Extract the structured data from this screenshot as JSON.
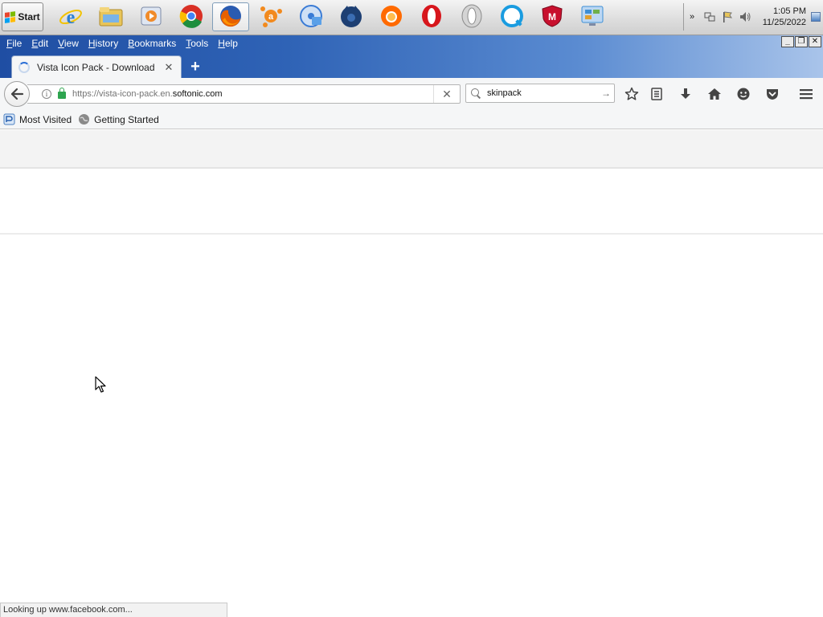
{
  "taskbar": {
    "start_label": "Start",
    "apps": [
      {
        "name": "internet-explorer-icon",
        "color": "#2a7fd4"
      },
      {
        "name": "file-explorer-icon",
        "color": "#e8c55a"
      },
      {
        "name": "media-player-icon",
        "color": "#f08b2b"
      },
      {
        "name": "chrome-icon",
        "color": "#d93025"
      },
      {
        "name": "firefox-icon",
        "color": "#e66000"
      },
      {
        "name": "avast-icon",
        "color": "#f28a1e"
      },
      {
        "name": "disc-burner-icon",
        "color": "#3a7bd5"
      },
      {
        "name": "waterfox-icon",
        "color": "#1d3f73"
      },
      {
        "name": "firefox-alt-icon",
        "color": "#ff6a00"
      },
      {
        "name": "opera-icon",
        "color": "#d7161c"
      },
      {
        "name": "opera-neon-icon",
        "color": "#b9b9b9"
      },
      {
        "name": "quicktime-icon",
        "color": "#1a9ce0"
      },
      {
        "name": "mcafee-icon",
        "color": "#c8102e"
      },
      {
        "name": "control-panel-icon",
        "color": "#3d8fd6"
      }
    ],
    "tray": {
      "clock_time": "1:05 PM",
      "clock_date": "11/25/2022"
    }
  },
  "browser": {
    "menu": [
      {
        "label": "File",
        "key": "F",
        "rest": "ile"
      },
      {
        "label": "Edit",
        "key": "E",
        "rest": "dit"
      },
      {
        "label": "View",
        "key": "V",
        "rest": "iew"
      },
      {
        "label": "History",
        "key": "H",
        "rest": "istory"
      },
      {
        "label": "Bookmarks",
        "key": "B",
        "rest": "ookmarks"
      },
      {
        "label": "Tools",
        "key": "T",
        "rest": "ools"
      },
      {
        "label": "Help",
        "key": "H",
        "rest": "elp"
      }
    ],
    "tab_title": "Vista Icon Pack - Download",
    "url_prefix": "https://vista-icon-pack.en.",
    "url_domain": "softonic.com",
    "search_value": "skinpack",
    "bookmarks": [
      {
        "label": "Most Visited",
        "icon": "most-visited-icon"
      },
      {
        "label": "Getting Started",
        "icon": "getting-started-icon"
      }
    ],
    "status_text": "Looking up www.facebook.com..."
  },
  "colors": {
    "titlebar_start": "#1f4ea3",
    "titlebar_end": "#a9c4ea",
    "toolbar_bg": "#f5f6f7"
  }
}
